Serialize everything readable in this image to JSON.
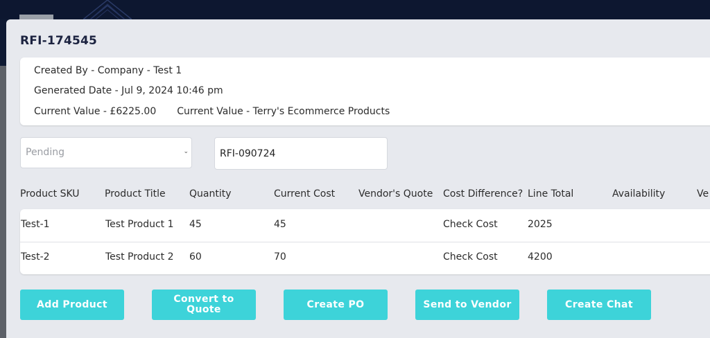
{
  "modal": {
    "title": "RFI-174545"
  },
  "info": {
    "created_by": "Created By - Company - Test 1",
    "generated_date": "Generated Date - Jul 9, 2024 10:46 pm",
    "current_value": "Current Value - £6225.00",
    "current_value_vendor": "Current Value - Terry's Ecommerce Products"
  },
  "status_select": {
    "selected": "Pending"
  },
  "reference_input": {
    "value": "RFI-090724"
  },
  "table": {
    "columns": [
      "Product SKU",
      "Product Title",
      "Quantity",
      "Current Cost",
      "Vendor's Quote",
      "Cost Difference?",
      "Line Total",
      "Availability",
      "Ve"
    ],
    "rows": [
      {
        "sku": "Test-1",
        "title": "Test Product 1",
        "quantity": "45",
        "current_cost": "45",
        "vendor_quote": "",
        "cost_difference": "Check Cost",
        "line_total": "2025",
        "availability": ""
      },
      {
        "sku": "Test-2",
        "title": "Test Product 2",
        "quantity": "60",
        "current_cost": "70",
        "vendor_quote": "",
        "cost_difference": "Check Cost",
        "line_total": "4200",
        "availability": ""
      }
    ]
  },
  "actions": {
    "add_product": "Add Product",
    "convert_to_quote": "Convert to Quote",
    "create_po": "Create PO",
    "send_to_vendor": "Send to Vendor",
    "create_chat": "Create Chat"
  },
  "colors": {
    "accent": "#3dd3d9",
    "header_bg": "#0d1730",
    "modal_bg": "#e7e9ee"
  }
}
